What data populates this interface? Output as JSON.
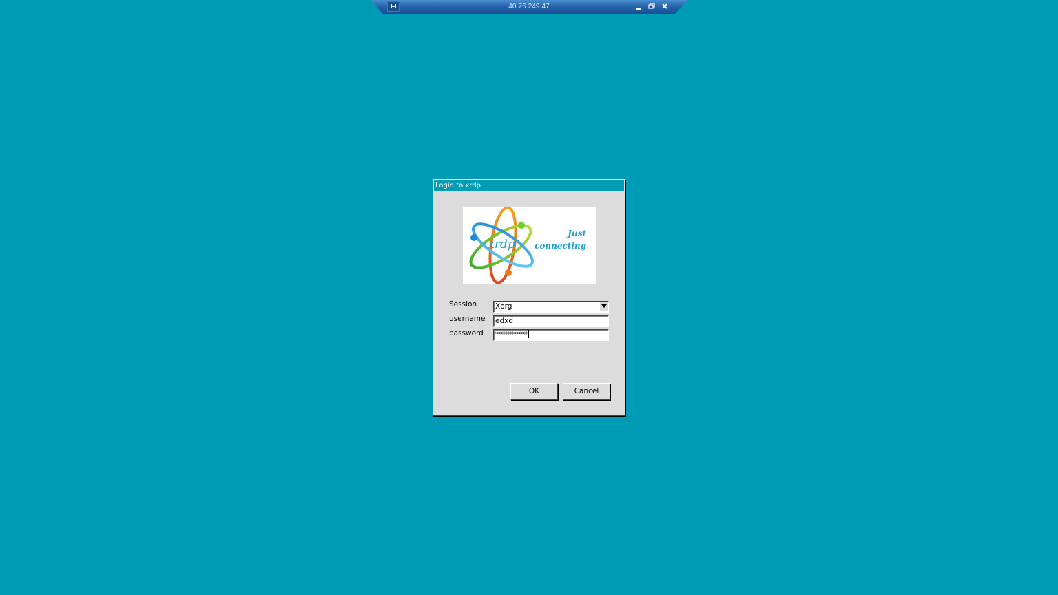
{
  "rdp_bar": {
    "title": "40.76.249.47",
    "pin_icon": "pin-icon",
    "minimize_icon": "minimize-icon",
    "restore_icon": "restore-icon",
    "close_icon": "close-icon"
  },
  "dialog": {
    "title": "Login to xrdp",
    "logo": {
      "brand": "xrdp",
      "tagline_line1": "Just",
      "tagline_line2": "connecting"
    },
    "fields": {
      "session_label": "Session",
      "session_value": "Xorg",
      "username_label": "username",
      "username_value": "edxd",
      "password_label": "password",
      "password_value": "****************"
    },
    "buttons": {
      "ok": "OK",
      "cancel": "Cancel"
    }
  },
  "colors": {
    "desktop_background": "#009cb6",
    "dialog_background": "#dcdcdc",
    "titlebar": "#009cb6"
  }
}
